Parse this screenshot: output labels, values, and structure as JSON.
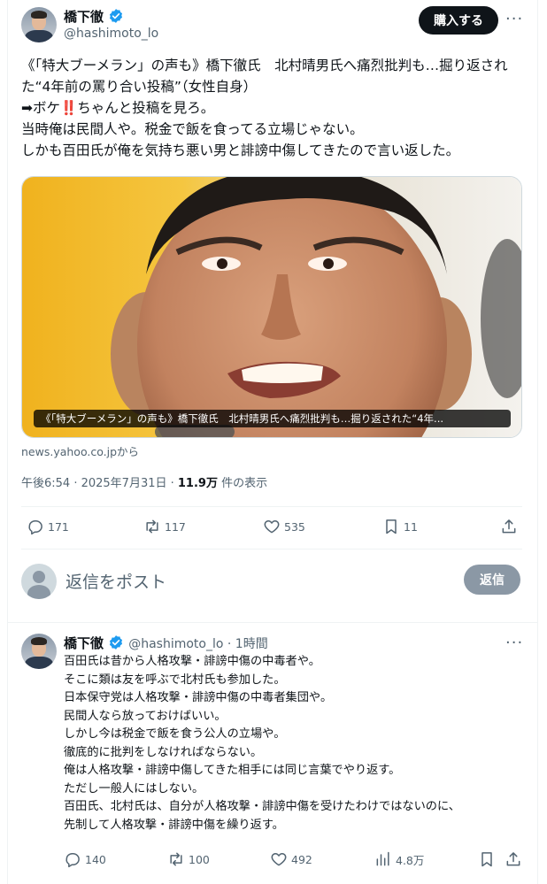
{
  "tweet": {
    "author_name": "橋下徹",
    "author_handle": "@hashimoto_lo",
    "buy_label": "購入する",
    "more_label": "···",
    "text": "《「特大ブーメラン」の声も》橋下徹氏　北村晴男氏へ痛烈批判も…掘り返された“4年前の罵り合い投稿”（女性自身）\n➡ボケ‼️ちゃんと投稿を見ろ。\n当時俺は民間人や。税金で飯を食ってる立場じゃない。\nしかも百田氏が俺を気持ち悪い男と誹謗中傷してきたので言い返した。",
    "card_caption": "《「特大ブーメラン」の声も》橋下徹氏　北村晴男氏へ痛烈批判も…掘り返された“4年...",
    "card_source": "news.yahoo.co.jpから",
    "time": "午後6:54 · 2025年7月31日 · ",
    "views": "11.9万",
    "views_suffix": " 件の表示",
    "stats": {
      "replies": "171",
      "reposts": "117",
      "likes": "535",
      "bookmarks": "11"
    }
  },
  "reply_box": {
    "placeholder": "返信をポスト",
    "button": "返信"
  },
  "reply": {
    "author_name": "橋下徹",
    "author_handle": "@hashimoto_lo",
    "time": " · 1時間",
    "more_label": "···",
    "text": "百田氏は昔から人格攻撃・誹謗中傷の中毒者や。\nそこに類は友を呼ぶで北村氏も参加した。\n日本保守党は人格攻撃・誹謗中傷の中毒者集団や。\n民間人なら放っておけばいい。\nしかし今は税金で飯を食う公人の立場や。\n徹底的に批判をしなければならない。\n俺は人格攻撃・誹謗中傷してきた相手には同じ言葉でやり返す。\nただし一般人にはしない。\n百田氏、北村氏は、自分が人格攻撃・誹謗中傷を受けたわけではないのに、\n先制して人格攻撃・誹謗中傷を繰り返す。",
    "stats": {
      "replies": "140",
      "reposts": "100",
      "likes": "492",
      "views": "4.8万"
    }
  },
  "colors": {
    "accent": "#1d9bf0",
    "text": "#0f1419",
    "muted": "#536471",
    "verified": "#1d9bf0"
  },
  "icons": [
    "verified-badge-icon",
    "reply-icon",
    "repost-icon",
    "like-icon",
    "bookmark-icon",
    "share-icon",
    "views-icon",
    "more-icon"
  ]
}
